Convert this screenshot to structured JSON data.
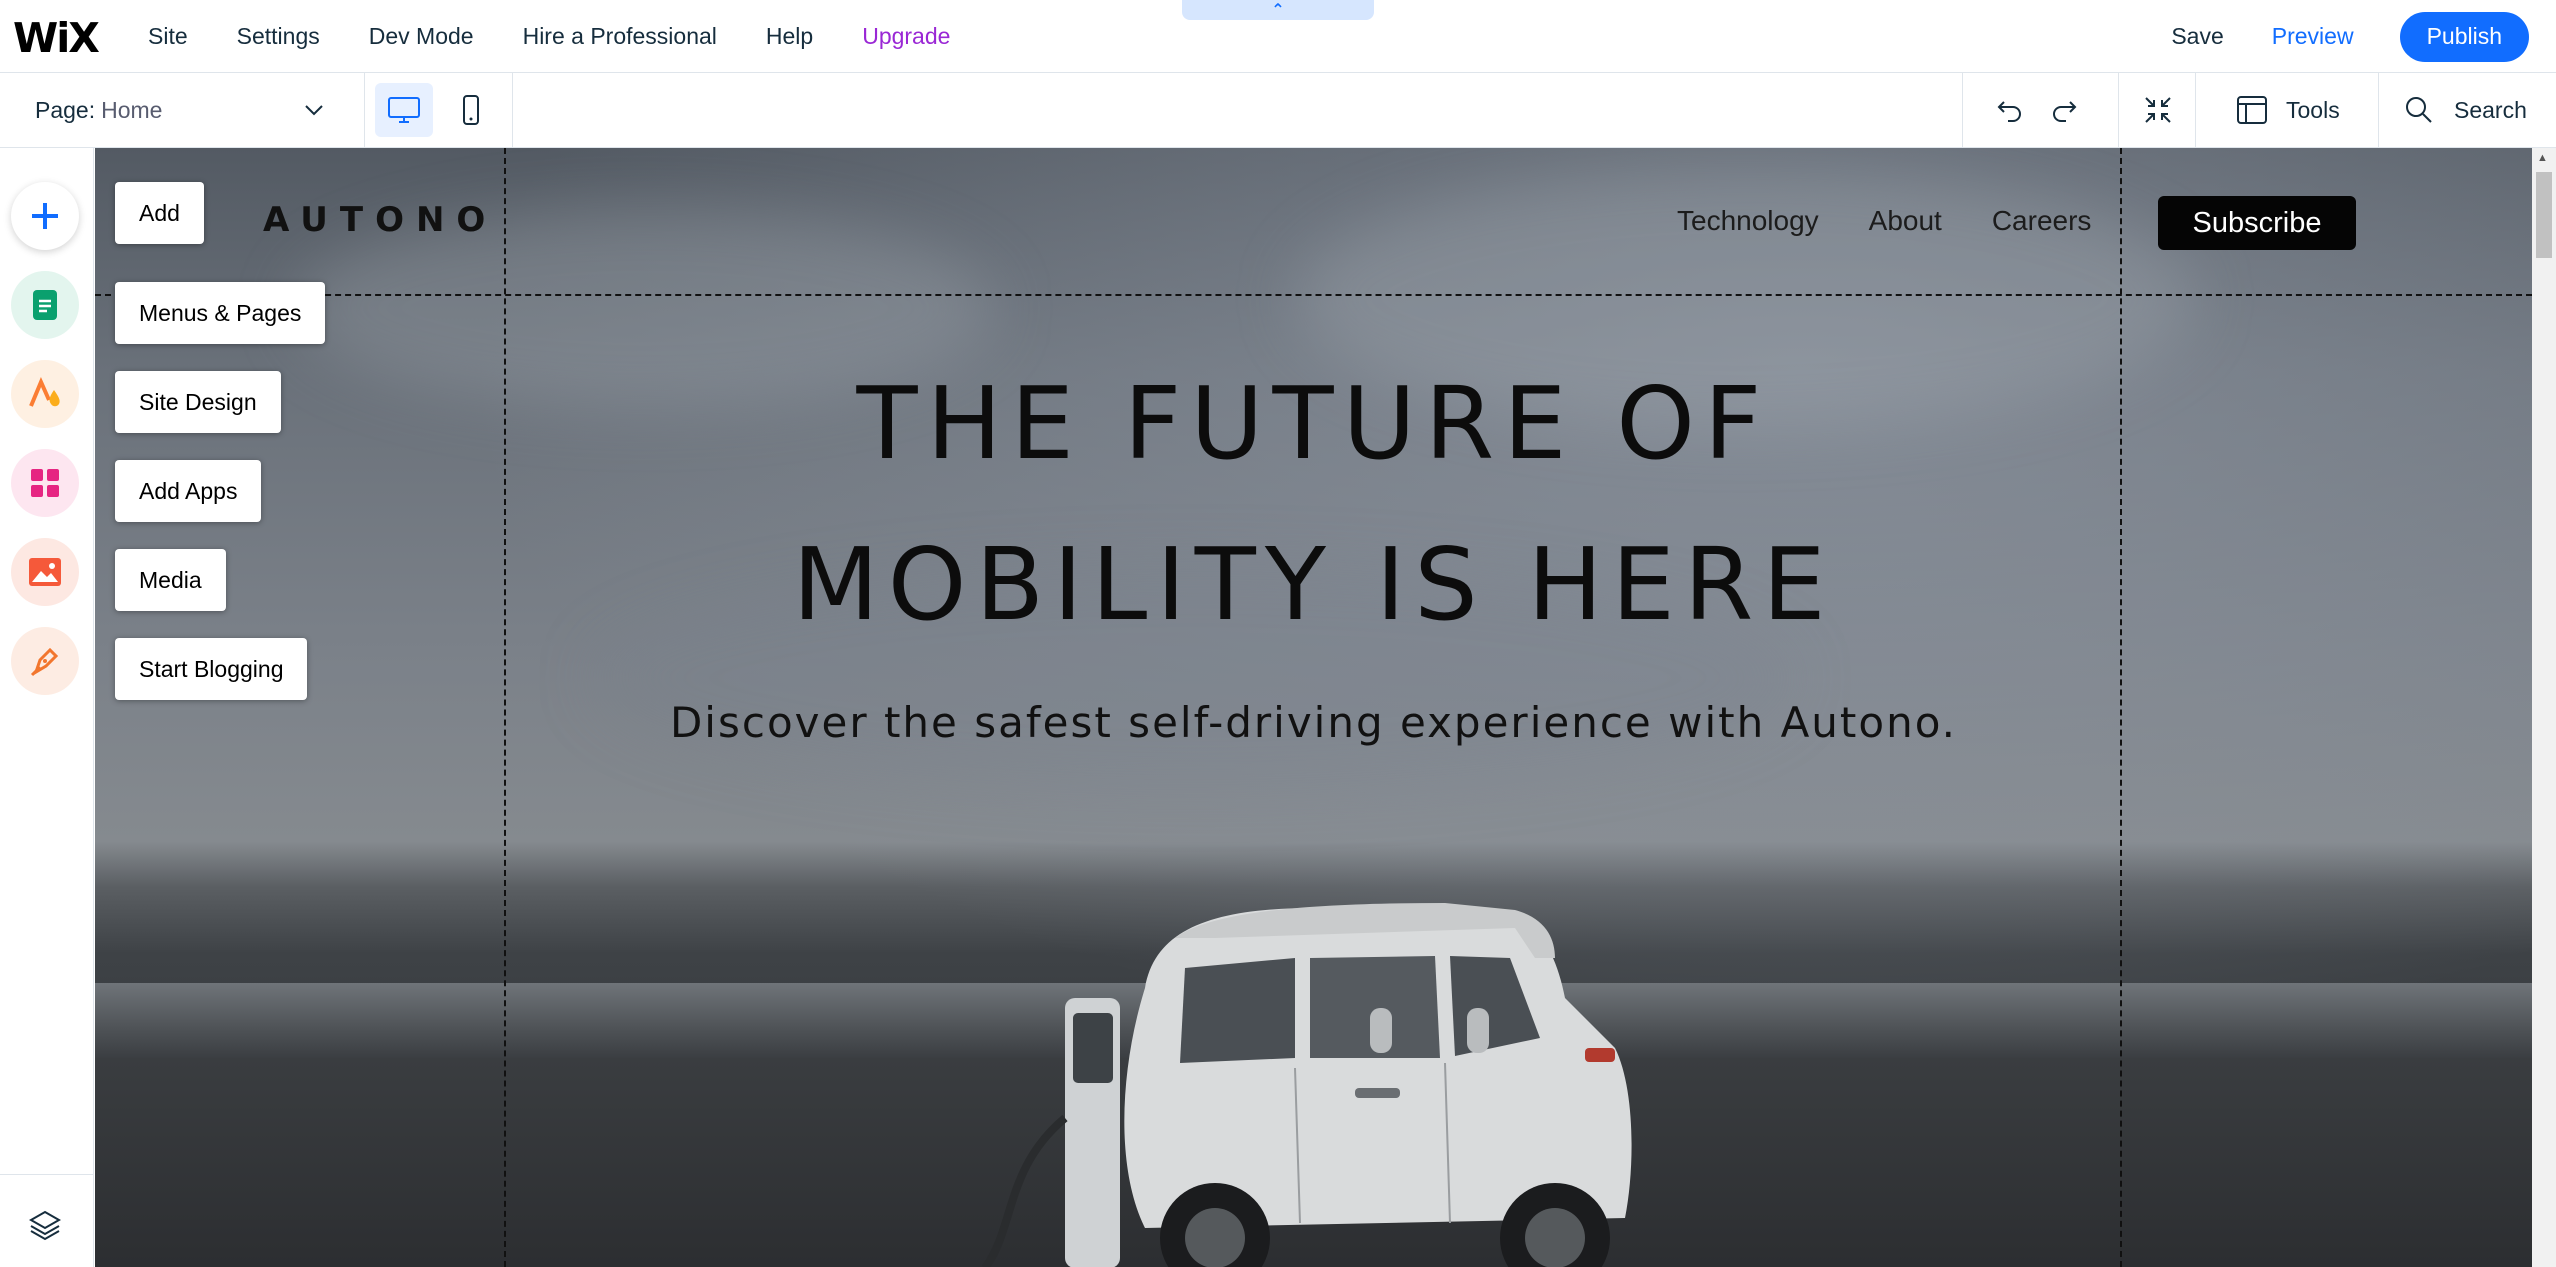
{
  "topbar": {
    "logo": "WiX",
    "menu": [
      "Site",
      "Settings",
      "Dev Mode",
      "Hire a Professional",
      "Help",
      "Upgrade"
    ],
    "collapse_glyph": "⌃",
    "save": "Save",
    "preview": "Preview",
    "publish": "Publish"
  },
  "subbar": {
    "page_label": "Page:",
    "page_value": "Home",
    "tools": "Tools",
    "search": "Search"
  },
  "rail": {
    "labels": [
      "Add",
      "Menus & Pages",
      "Site Design",
      "Add Apps",
      "Media",
      "Start Blogging"
    ],
    "icons": [
      "plus-icon",
      "pages-icon",
      "site-design-icon",
      "add-apps-icon",
      "media-icon",
      "blog-icon",
      "layers-icon"
    ]
  },
  "site": {
    "logo": "AUTONO",
    "nav": [
      "Technology",
      "About",
      "Careers"
    ],
    "subscribe": "Subscribe",
    "hero_line1": "THE FUTURE OF",
    "hero_line2": "MOBILITY IS HERE",
    "hero_sub": "Discover the safest self-driving experience with Autono."
  },
  "colors": {
    "accent": "#116dff",
    "upgrade": "#9a27d5"
  }
}
